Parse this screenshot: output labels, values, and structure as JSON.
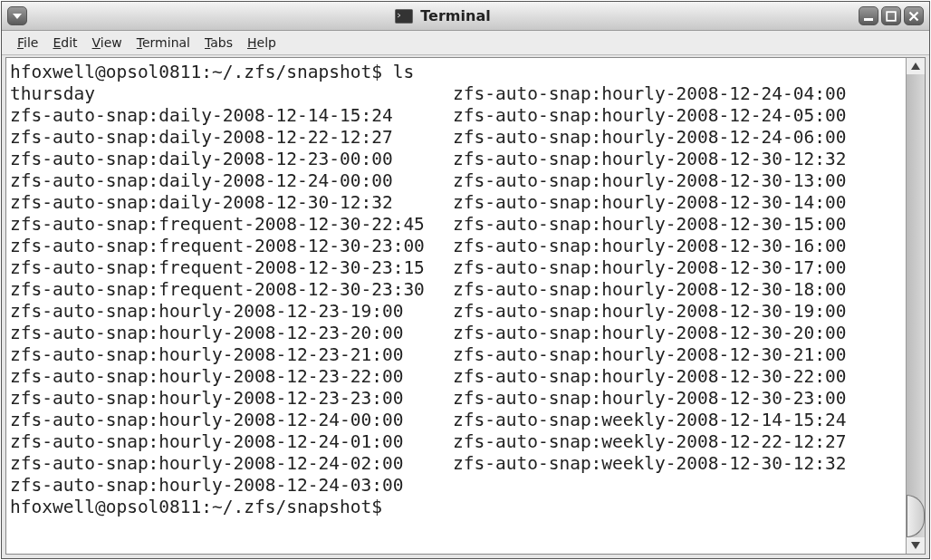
{
  "window": {
    "title": "Terminal"
  },
  "menu": [
    {
      "label": "File"
    },
    {
      "label": "Edit"
    },
    {
      "label": "View"
    },
    {
      "label": "Terminal"
    },
    {
      "label": "Tabs"
    },
    {
      "label": "Help"
    }
  ],
  "terminal": {
    "lines": [
      {
        "kind": "prompt",
        "text": "hfoxwell@opsol0811:~/.zfs/snapshot$ ls"
      },
      {
        "kind": "output",
        "columns": [
          "thursday",
          "zfs-auto-snap:hourly-2008-12-24-04:00"
        ]
      },
      {
        "kind": "output",
        "columns": [
          "zfs-auto-snap:daily-2008-12-14-15:24",
          "zfs-auto-snap:hourly-2008-12-24-05:00"
        ]
      },
      {
        "kind": "output",
        "columns": [
          "zfs-auto-snap:daily-2008-12-22-12:27",
          "zfs-auto-snap:hourly-2008-12-24-06:00"
        ]
      },
      {
        "kind": "output",
        "columns": [
          "zfs-auto-snap:daily-2008-12-23-00:00",
          "zfs-auto-snap:hourly-2008-12-30-12:32"
        ]
      },
      {
        "kind": "output",
        "columns": [
          "zfs-auto-snap:daily-2008-12-24-00:00",
          "zfs-auto-snap:hourly-2008-12-30-13:00"
        ]
      },
      {
        "kind": "output",
        "columns": [
          "zfs-auto-snap:daily-2008-12-30-12:32",
          "zfs-auto-snap:hourly-2008-12-30-14:00"
        ]
      },
      {
        "kind": "output",
        "columns": [
          "zfs-auto-snap:frequent-2008-12-30-22:45",
          "zfs-auto-snap:hourly-2008-12-30-15:00"
        ]
      },
      {
        "kind": "output",
        "columns": [
          "zfs-auto-snap:frequent-2008-12-30-23:00",
          "zfs-auto-snap:hourly-2008-12-30-16:00"
        ]
      },
      {
        "kind": "output",
        "columns": [
          "zfs-auto-snap:frequent-2008-12-30-23:15",
          "zfs-auto-snap:hourly-2008-12-30-17:00"
        ]
      },
      {
        "kind": "output",
        "columns": [
          "zfs-auto-snap:frequent-2008-12-30-23:30",
          "zfs-auto-snap:hourly-2008-12-30-18:00"
        ]
      },
      {
        "kind": "output",
        "columns": [
          "zfs-auto-snap:hourly-2008-12-23-19:00",
          "zfs-auto-snap:hourly-2008-12-30-19:00"
        ]
      },
      {
        "kind": "output",
        "columns": [
          "zfs-auto-snap:hourly-2008-12-23-20:00",
          "zfs-auto-snap:hourly-2008-12-30-20:00"
        ]
      },
      {
        "kind": "output",
        "columns": [
          "zfs-auto-snap:hourly-2008-12-23-21:00",
          "zfs-auto-snap:hourly-2008-12-30-21:00"
        ]
      },
      {
        "kind": "output",
        "columns": [
          "zfs-auto-snap:hourly-2008-12-23-22:00",
          "zfs-auto-snap:hourly-2008-12-30-22:00"
        ]
      },
      {
        "kind": "output",
        "columns": [
          "zfs-auto-snap:hourly-2008-12-23-23:00",
          "zfs-auto-snap:hourly-2008-12-30-23:00"
        ]
      },
      {
        "kind": "output",
        "columns": [
          "zfs-auto-snap:hourly-2008-12-24-00:00",
          "zfs-auto-snap:weekly-2008-12-14-15:24"
        ]
      },
      {
        "kind": "output",
        "columns": [
          "zfs-auto-snap:hourly-2008-12-24-01:00",
          "zfs-auto-snap:weekly-2008-12-22-12:27"
        ]
      },
      {
        "kind": "output",
        "columns": [
          "zfs-auto-snap:hourly-2008-12-24-02:00",
          "zfs-auto-snap:weekly-2008-12-30-12:32"
        ]
      },
      {
        "kind": "output",
        "columns": [
          "zfs-auto-snap:hourly-2008-12-24-03:00"
        ]
      },
      {
        "kind": "prompt",
        "text": "hfoxwell@opsol0811:~/.zfs/snapshot$"
      }
    ]
  }
}
